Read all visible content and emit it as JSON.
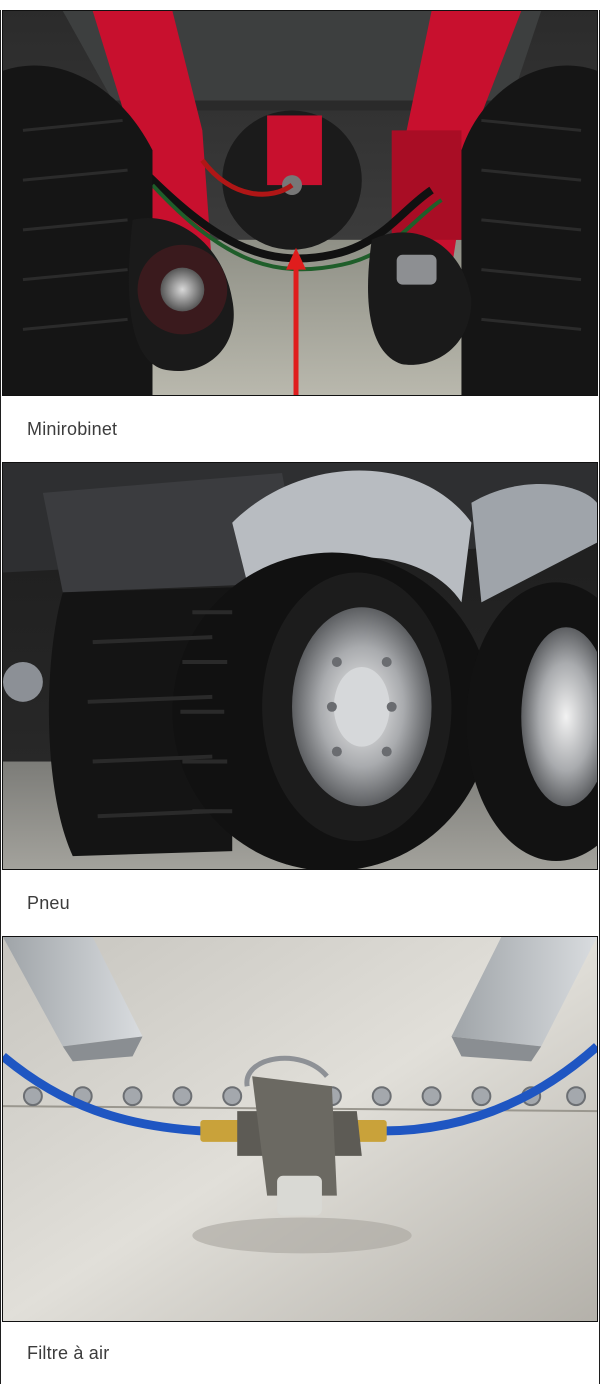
{
  "gallery": {
    "items": [
      {
        "caption": "Minirobinet",
        "image_icon": "mini-valve-under-trailer-photo"
      },
      {
        "caption": "Pneu",
        "image_icon": "truck-tire-photo"
      },
      {
        "caption": "Filtre à air",
        "image_icon": "air-filter-photo"
      }
    ]
  },
  "colors": {
    "trailer_red": "#c8102e",
    "arrow_red": "#e01d1d",
    "air_hose_blue": "#1f56c2",
    "caption_text": "#3c3c3c"
  }
}
